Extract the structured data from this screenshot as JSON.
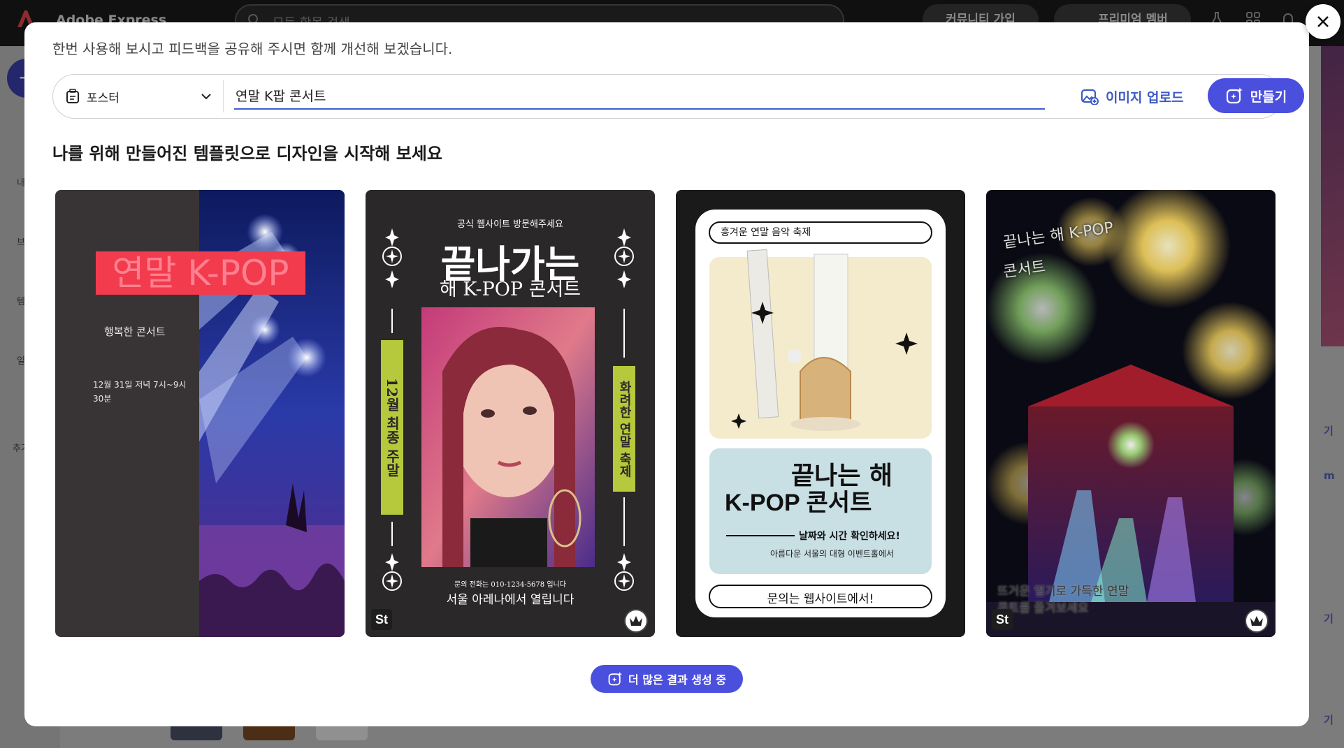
{
  "background_app": {
    "brand": "Adobe Express",
    "search_placeholder": "모든 항목 검색",
    "community_button": "커뮤니티 가입",
    "premium_button": "프리미엄 멤버",
    "sidebar_items": [
      "내",
      "브",
      "템",
      "일",
      "추가"
    ],
    "right_links": [
      "기",
      "m",
      "기",
      "기"
    ]
  },
  "modal": {
    "feedback_text": "한번 사용해 보시고 피드백을 공유해 주시면 함께 개선해 보겠습니다.",
    "type_selector": {
      "label": "포스터"
    },
    "prompt": {
      "value": "연말 K팝 콘서트"
    },
    "upload_button": "이미지 업로드",
    "create_button": "만들기",
    "section_title": "나를 위해 만들어진 템플릿으로 디자인을 시작해 보세요",
    "more_button": "더 많은 결과 생성 중",
    "templates": [
      {
        "title": "연말 K-POP",
        "subtitle": "행복한 콘서트",
        "date": "12월 31일 저녁 7시~9시",
        "date2": "30분"
      },
      {
        "top": "공식 웹사이트 방문해주세요",
        "title1": "끝나가는",
        "title2": "해 K-POP 콘서트",
        "left_vertical": "12월 최종 주말",
        "right_vertical": "화려한 연말 축제",
        "contact": "문의 전화는 010-1234-5678 입니다",
        "venue": "서울 아레나에서 열립니다",
        "badge": "St"
      },
      {
        "top": "흥겨운 연말 음악 축제",
        "title1": "끝나는 해",
        "title2": "K-POP 콘서트",
        "info1": "날짜와 시간 확인하세요!",
        "info2": "아름다운 서울의 대형 이벤트홀에서",
        "footer": "문의는 웹사이트에서!"
      },
      {
        "title1": "끝나는 해 K-POP",
        "title2": "콘서트",
        "bottom1": "뜨거운 열기로 가득한 연말",
        "bottom2": "콘트를 즐겨보세요",
        "badge": "St"
      }
    ]
  },
  "colors": {
    "accent": "#4b4fde",
    "link": "#3c5ac4",
    "poster1_red": "#f23b4d",
    "poster2_green": "#b6c93c",
    "poster3_cream": "#f3ebcc",
    "poster3_blue": "#c8dfe4"
  }
}
